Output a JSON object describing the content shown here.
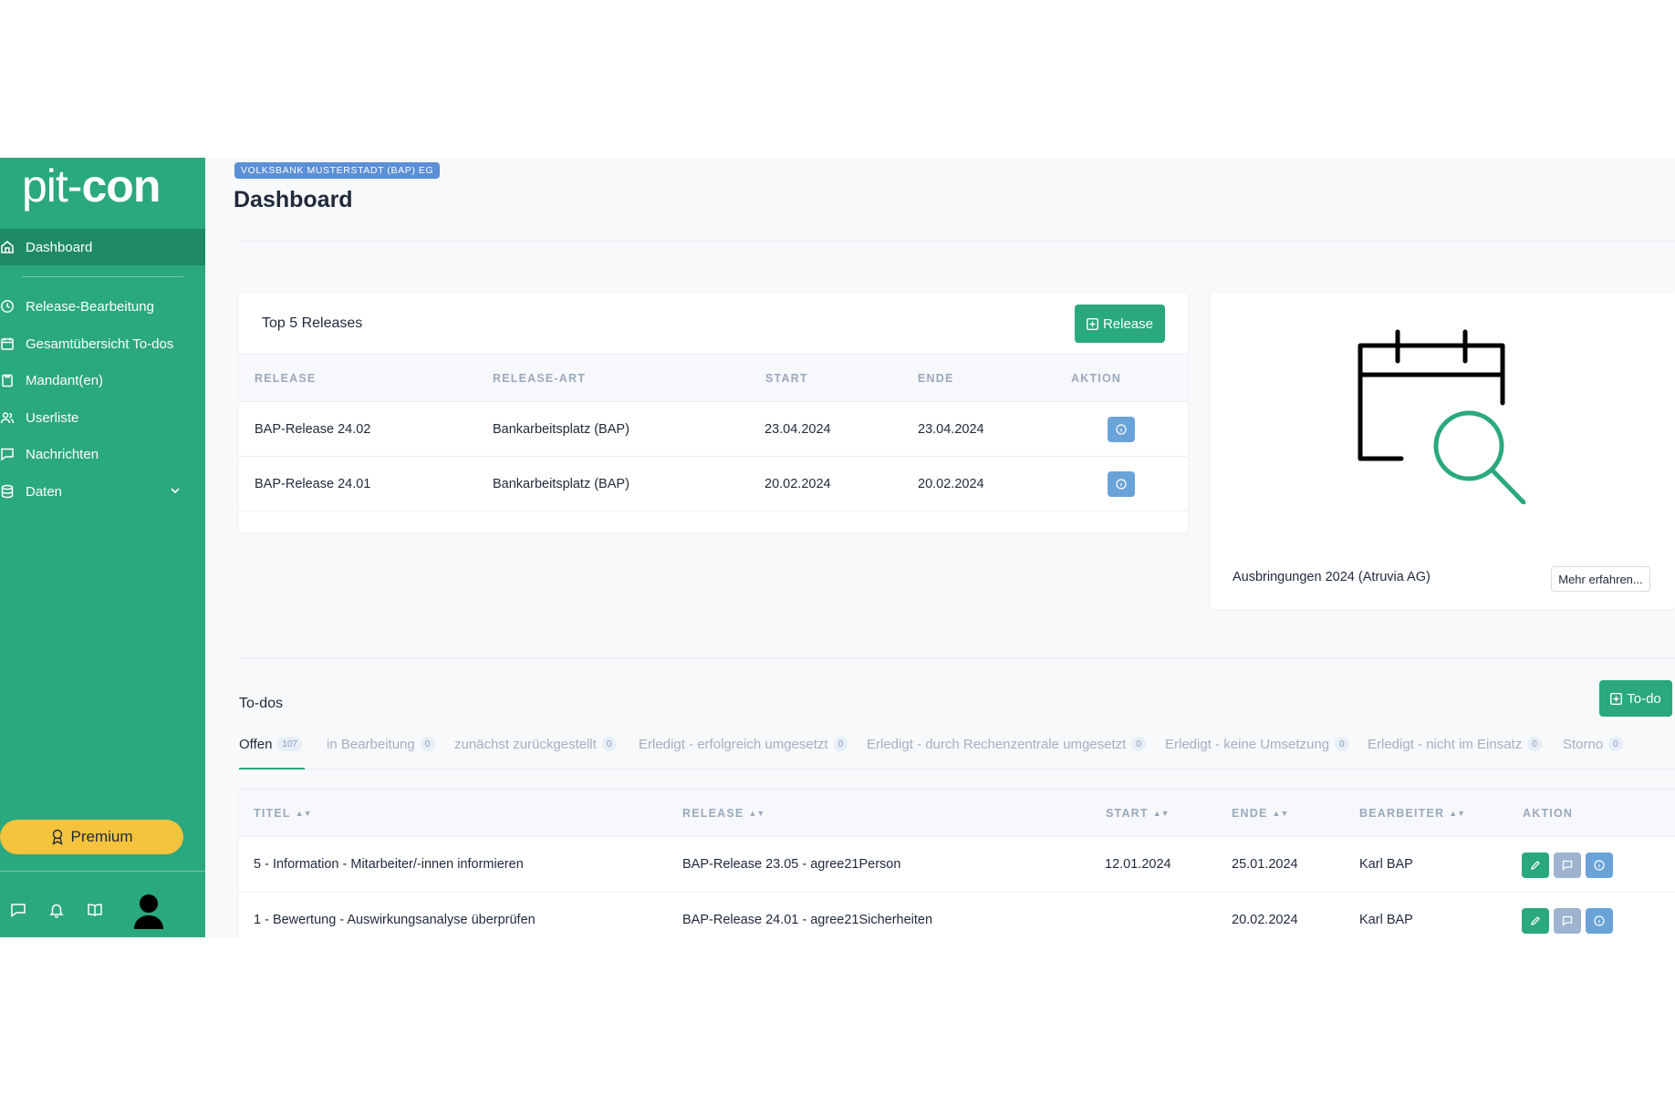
{
  "brand": {
    "part1": "pit-",
    "part2": "con"
  },
  "nav": [
    {
      "label": "Dashboard",
      "icon": "home-icon",
      "active": true
    },
    {
      "label": "Release-Bearbeitung",
      "icon": "clock-icon"
    },
    {
      "label": "Gesamtübersicht To-dos",
      "icon": "calendar-icon"
    },
    {
      "label": "Mandant(en)",
      "icon": "clipboard-icon"
    },
    {
      "label": "Userliste",
      "icon": "users-icon"
    },
    {
      "label": "Nachrichten",
      "icon": "message-icon"
    },
    {
      "label": "Daten",
      "icon": "database-icon"
    }
  ],
  "premium_label": "Premium",
  "header": {
    "org": "VOLKSBANK MUSTERSTADT (BAP) EG",
    "title": "Dashboard"
  },
  "releases": {
    "title": "Top 5 Releases",
    "add_button": "Release",
    "columns": [
      "RELEASE",
      "RELEASE-ART",
      "START",
      "ENDE",
      "AKTION"
    ],
    "rows": [
      {
        "release": "BAP-Release 24.02",
        "art": "Bankarbeitsplatz (BAP)",
        "start": "23.04.2024",
        "ende": "23.04.2024"
      },
      {
        "release": "BAP-Release 24.01",
        "art": "Bankarbeitsplatz (BAP)",
        "start": "20.02.2024",
        "ende": "20.02.2024"
      }
    ]
  },
  "promo": {
    "text": "Ausbringungen 2024 (Atruvia AG)",
    "button": "Mehr erfahren..."
  },
  "todos": {
    "title": "To-dos",
    "add_button": "To-do",
    "tabs": [
      {
        "label": "Offen",
        "count": "107"
      },
      {
        "label": "in Bearbeitung",
        "count": "0"
      },
      {
        "label": "zunächst zurückgestellt",
        "count": "0"
      },
      {
        "label": "Erledigt - erfolgreich umgesetzt",
        "count": "0"
      },
      {
        "label": "Erledigt - durch Rechenzentrale umgesetzt",
        "count": "0"
      },
      {
        "label": "Erledigt - keine Umsetzung",
        "count": "0"
      },
      {
        "label": "Erledigt - nicht im Einsatz",
        "count": "0"
      },
      {
        "label": "Storno",
        "count": "0"
      }
    ],
    "columns": [
      "TITEL",
      "RELEASE",
      "START",
      "ENDE",
      "BEARBEITER",
      "AKTION"
    ],
    "rows": [
      {
        "titel": "5 - Information - Mitarbeiter/-innen informieren",
        "release": "BAP-Release 23.05 - agree21Person",
        "start": "12.01.2024",
        "ende": "25.01.2024",
        "bearbeiter": "Karl BAP"
      },
      {
        "titel": "1 - Bewertung - Auswirkungsanalyse überprüfen",
        "release": "BAP-Release 24.01 - agree21Sicherheiten",
        "start": "",
        "ende": "20.02.2024",
        "bearbeiter": "Karl BAP"
      }
    ]
  },
  "colors": {
    "primary": "#2aa87e",
    "primary_dark": "#1f8a66",
    "premium": "#f6c33c",
    "info": "#6aa3d8",
    "badge": "#5b8fd6"
  }
}
